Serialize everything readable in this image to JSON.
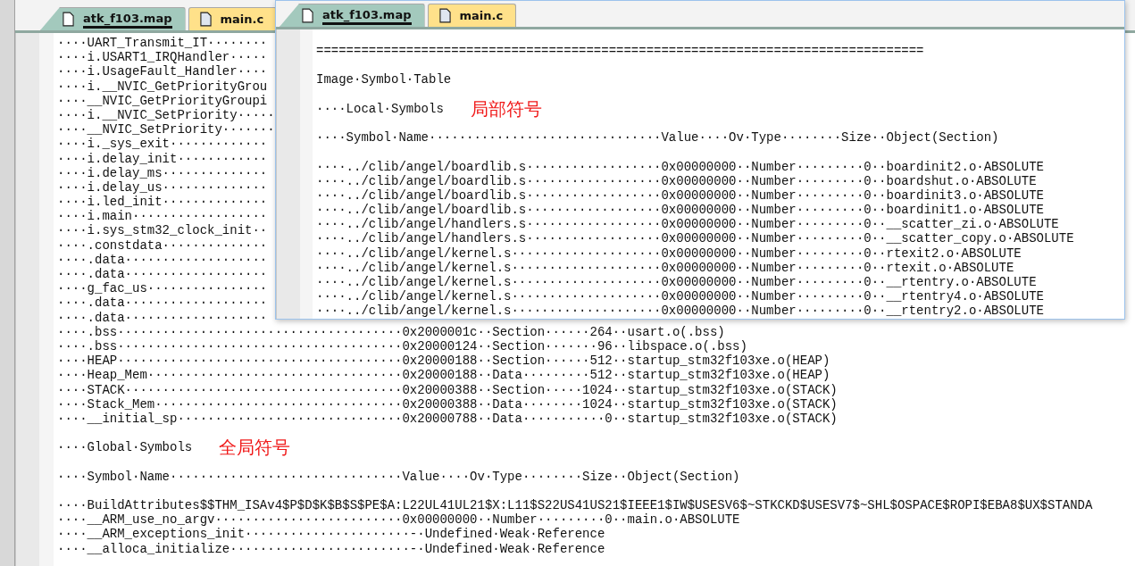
{
  "editor": {
    "tabs": [
      {
        "label": "atk_f103.map",
        "selected": true
      },
      {
        "label": "main.c",
        "selected": false
      }
    ],
    "lines": [
      {
        "kind": "text",
        "text": "····UART_Transmit_IT········"
      },
      {
        "kind": "text",
        "text": "····i.USART1_IRQHandler·····"
      },
      {
        "kind": "text",
        "text": "····i.UsageFault_Handler····"
      },
      {
        "kind": "text",
        "text": "····i.__NVIC_GetPriorityGrou"
      },
      {
        "kind": "text",
        "text": "····__NVIC_GetPriorityGroupi"
      },
      {
        "kind": "text",
        "text": "····i.__NVIC_SetPriority·····"
      },
      {
        "kind": "text",
        "text": "····__NVIC_SetPriority·······"
      },
      {
        "kind": "text",
        "text": "····i._sys_exit·············"
      },
      {
        "kind": "text",
        "text": "····i.delay_init············"
      },
      {
        "kind": "text",
        "text": "····i.delay_ms··············"
      },
      {
        "kind": "text",
        "text": "····i.delay_us··············"
      },
      {
        "kind": "text",
        "text": "····i.led_init··············"
      },
      {
        "kind": "text",
        "text": "····i.main··················"
      },
      {
        "kind": "text",
        "text": "····i.sys_stm32_clock_init··"
      },
      {
        "kind": "text",
        "text": "····.constdata··············"
      },
      {
        "kind": "text",
        "text": "····.data···················"
      },
      {
        "kind": "text",
        "text": "····.data···················"
      },
      {
        "kind": "text",
        "text": "····g_fac_us················"
      },
      {
        "kind": "text",
        "text": "····.data···················"
      },
      {
        "kind": "text",
        "text": "····.data···················"
      },
      {
        "kind": "text",
        "text": "····.bss······································0x2000001c··Section······264··usart.o(.bss)"
      },
      {
        "kind": "text",
        "text": "····.bss······································0x20000124··Section·······96··libspace.o(.bss)"
      },
      {
        "kind": "text",
        "text": "····HEAP······································0x20000188··Section······512··startup_stm32f103xe.o(HEAP)"
      },
      {
        "kind": "text",
        "text": "····Heap_Mem··································0x20000188··Data·········512··startup_stm32f103xe.o(HEAP)"
      },
      {
        "kind": "text",
        "text": "····STACK·····································0x20000388··Section·····1024··startup_stm32f103xe.o(STACK)"
      },
      {
        "kind": "text",
        "text": "····Stack_Mem·································0x20000388··Data········1024··startup_stm32f103xe.o(STACK)"
      },
      {
        "kind": "text",
        "text": "····__initial_sp······························0x20000788··Data···········0··startup_stm32f103xe.o(STACK)"
      },
      {
        "kind": "blank"
      },
      {
        "kind": "text",
        "text": "····Global·Symbols",
        "note": "全局符号"
      },
      {
        "kind": "blank"
      },
      {
        "kind": "text",
        "text": "····Symbol·Name·······························Value····Ov·Type········Size··Object(Section)"
      },
      {
        "kind": "blank"
      },
      {
        "kind": "text",
        "text": "····BuildAttributes$$THM_ISAv4$P$D$K$B$S$PE$A:L22UL41UL21$X:L11$S22US41US21$IEEE1$IW$USESV6$~STKCKD$USESV7$~SHL$OSPACE$ROPI$EBA8$UX$STANDA"
      },
      {
        "kind": "text",
        "text": "····__ARM_use_no_argv·························0x00000000··Number·········0··main.o·ABSOLUTE"
      },
      {
        "kind": "text",
        "text": "····__ARM_exceptions_init······················-·Undefined·Weak·Reference"
      },
      {
        "kind": "text",
        "text": "····__alloca_initialize························-·Undefined·Weak·Reference"
      }
    ]
  },
  "overlay_window": {
    "tabs": [
      {
        "label": "atk_f103.map",
        "selected": true
      },
      {
        "label": "main.c",
        "selected": false
      }
    ],
    "lines": [
      {
        "kind": "text",
        "text": "================================================================================="
      },
      {
        "kind": "blank"
      },
      {
        "kind": "text",
        "text": "Image·Symbol·Table"
      },
      {
        "kind": "blank"
      },
      {
        "kind": "text",
        "text": "····Local·Symbols",
        "note": "局部符号"
      },
      {
        "kind": "blank"
      },
      {
        "kind": "text",
        "text": "····Symbol·Name·······························Value····Ov·Type········Size··Object(Section)"
      },
      {
        "kind": "blank"
      },
      {
        "kind": "text",
        "text": "····../clib/angel/boardlib.s··················0x00000000··Number·········0··boardinit2.o·ABSOLUTE"
      },
      {
        "kind": "text",
        "text": "····../clib/angel/boardlib.s··················0x00000000··Number·········0··boardshut.o·ABSOLUTE"
      },
      {
        "kind": "text",
        "text": "····../clib/angel/boardlib.s··················0x00000000··Number·········0··boardinit3.o·ABSOLUTE"
      },
      {
        "kind": "text",
        "text": "····../clib/angel/boardlib.s··················0x00000000··Number·········0··boardinit1.o·ABSOLUTE"
      },
      {
        "kind": "text",
        "text": "····../clib/angel/handlers.s··················0x00000000··Number·········0··__scatter_zi.o·ABSOLUTE"
      },
      {
        "kind": "text",
        "text": "····../clib/angel/handlers.s··················0x00000000··Number·········0··__scatter_copy.o·ABSOLUTE"
      },
      {
        "kind": "text",
        "text": "····../clib/angel/kernel.s····················0x00000000··Number·········0··rtexit2.o·ABSOLUTE"
      },
      {
        "kind": "text",
        "text": "····../clib/angel/kernel.s····················0x00000000··Number·········0··rtexit.o·ABSOLUTE"
      },
      {
        "kind": "text",
        "text": "····../clib/angel/kernel.s····················0x00000000··Number·········0··__rtentry.o·ABSOLUTE"
      },
      {
        "kind": "text",
        "text": "····../clib/angel/kernel.s····················0x00000000··Number·········0··__rtentry4.o·ABSOLUTE"
      },
      {
        "kind": "text",
        "text": "····../clib/angel/kernel.s····················0x00000000··Number·········0··__rtentry2.o·ABSOLUTE"
      }
    ]
  }
}
